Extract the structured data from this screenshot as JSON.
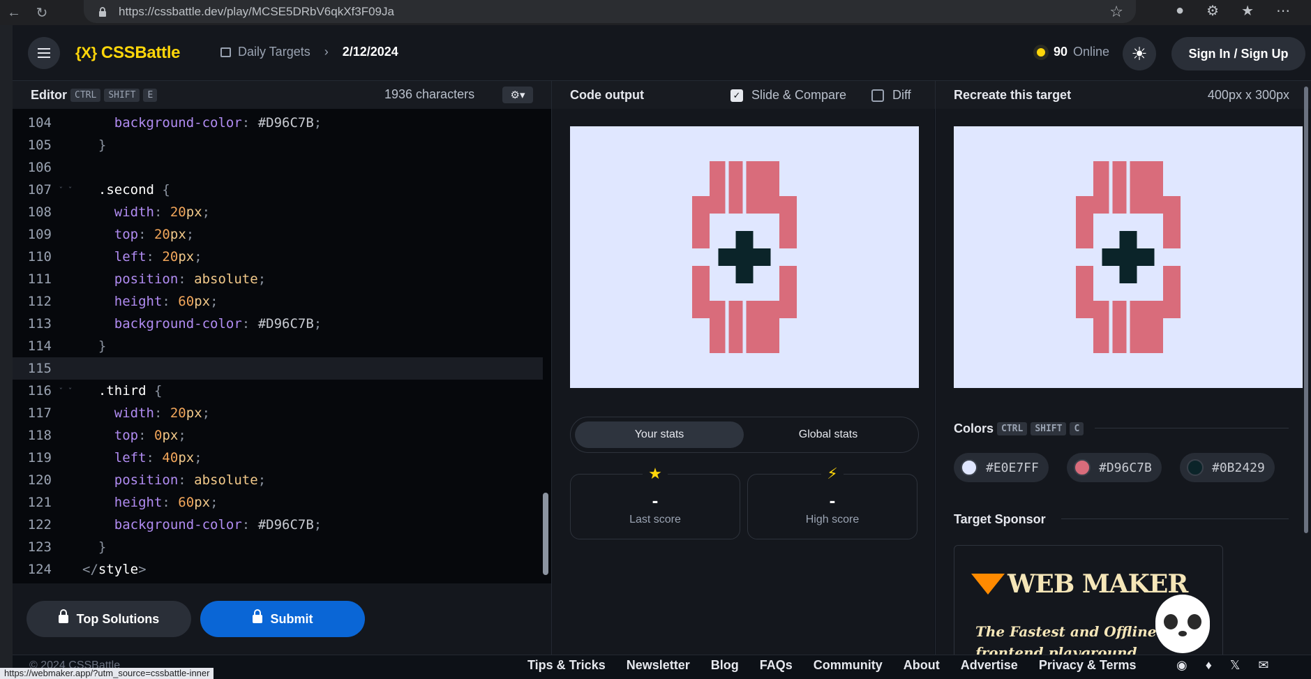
{
  "browser": {
    "url": "https://cssbattle.dev/play/MCSE5DRbV6qkXf3F09Ja"
  },
  "header": {
    "logo_mark": "{X}",
    "logo_text": "CSSBattle",
    "crumb_section": "Daily Targets",
    "crumb_date": "2/12/2024",
    "online_count": "90",
    "online_label": "Online",
    "signin_label": "Sign In / Sign Up"
  },
  "editor": {
    "title": "Editor",
    "shortcut": [
      "CTRL",
      "SHIFT",
      "E"
    ],
    "char_count": "1936 characters",
    "lines": [
      {
        "n": "104",
        "text": "    background-color: #D96C7B;"
      },
      {
        "n": "105",
        "text": "  }"
      },
      {
        "n": "106",
        "text": ""
      },
      {
        "n": "107",
        "text": "  .second {"
      },
      {
        "n": "108",
        "text": "    width: 20px;"
      },
      {
        "n": "109",
        "text": "    top: 20px;"
      },
      {
        "n": "110",
        "text": "    left: 20px;"
      },
      {
        "n": "111",
        "text": "    position: absolute;"
      },
      {
        "n": "112",
        "text": "    height: 60px;"
      },
      {
        "n": "113",
        "text": "    background-color: #D96C7B;"
      },
      {
        "n": "114",
        "text": "  }"
      },
      {
        "n": "115",
        "text": ""
      },
      {
        "n": "116",
        "text": "  .third {"
      },
      {
        "n": "117",
        "text": "    width: 20px;"
      },
      {
        "n": "118",
        "text": "    top: 0px;"
      },
      {
        "n": "119",
        "text": "    left: 40px;"
      },
      {
        "n": "120",
        "text": "    position: absolute;"
      },
      {
        "n": "121",
        "text": "    height: 60px;"
      },
      {
        "n": "122",
        "text": "    background-color: #D96C7B;"
      },
      {
        "n": "123",
        "text": "  }"
      },
      {
        "n": "124",
        "text": "</style>"
      }
    ],
    "top_solutions_label": "Top Solutions",
    "submit_label": "Submit"
  },
  "output": {
    "title": "Code output",
    "slide_compare_label": "Slide & Compare",
    "diff_label": "Diff",
    "tab_your_stats": "Your stats",
    "tab_global_stats": "Global stats",
    "last_score_value": "-",
    "last_score_label": "Last score",
    "high_score_value": "-",
    "high_score_label": "High score"
  },
  "target": {
    "title": "Recreate this target",
    "dimensions": "400px x 300px",
    "colors_title": "Colors",
    "colors_shortcut": [
      "CTRL",
      "SHIFT",
      "C"
    ],
    "colors": [
      "#E0E7FF",
      "#D96C7B",
      "#0B2429"
    ],
    "sponsor_title": "Target Sponsor",
    "sponsor_logo": "WEB MAKER",
    "sponsor_tagline_1": "The Fastest and Offline",
    "sponsor_tagline_2": "frontend playground"
  },
  "footer": {
    "copyright": "© 2024 CSSBattle",
    "status_url": "https://webmaker.app/?utm_source=cssbattle-inner",
    "links": [
      "Tips & Tricks",
      "Newsletter",
      "Blog",
      "FAQs",
      "Community",
      "About",
      "Advertise",
      "Privacy & Terms"
    ]
  },
  "theme": {
    "accent": "#FFD60A",
    "submit_blue": "#0A66D6"
  }
}
